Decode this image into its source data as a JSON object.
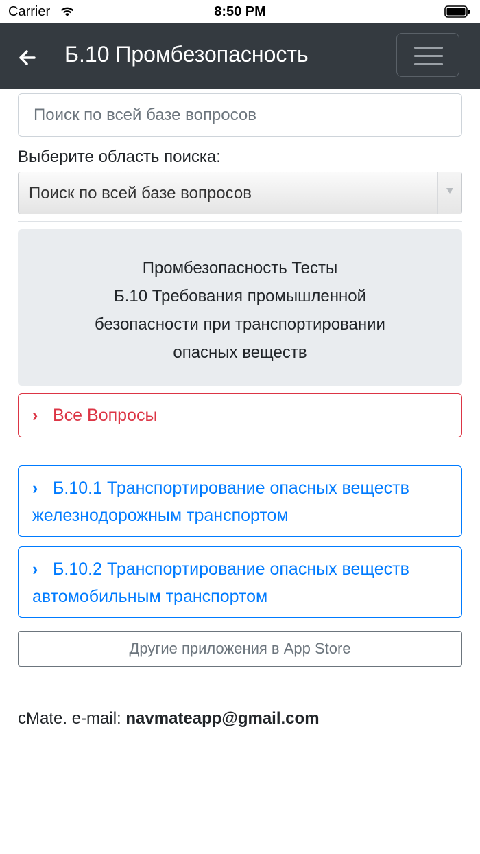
{
  "status": {
    "carrier": "Carrier",
    "time": "8:50 PM"
  },
  "header": {
    "title": "Б.10 Промбезопасность"
  },
  "search": {
    "placeholder": "Поиск по всей базе вопросов",
    "area_label": "Выберите область поиска:",
    "area_selected": "Поиск по всей базе вопросов"
  },
  "intro": {
    "lines": [
      "Промбезопасность Тесты",
      "Б.10 Требования промышленной",
      "безопасности при транспортировании",
      "опасных веществ"
    ]
  },
  "sections": {
    "all": "Все Вопросы",
    "items": [
      {
        "line1": "Б.10.1 Транспортирование опасных веществ",
        "line2": "железнодорожным транспортом"
      },
      {
        "line1": "Б.10.2 Транспортирование опасных веществ",
        "line2": "автомобильным транспортом"
      }
    ]
  },
  "other_apps": "Другие приложения в App Store",
  "footer": {
    "prefix": "cMate. e-mail: ",
    "email": "navmateapp@gmail.com"
  },
  "colors": {
    "navbar": "#343a40",
    "danger": "#dc3545",
    "primary": "#007bff",
    "jumbotron": "#e9ecef"
  }
}
